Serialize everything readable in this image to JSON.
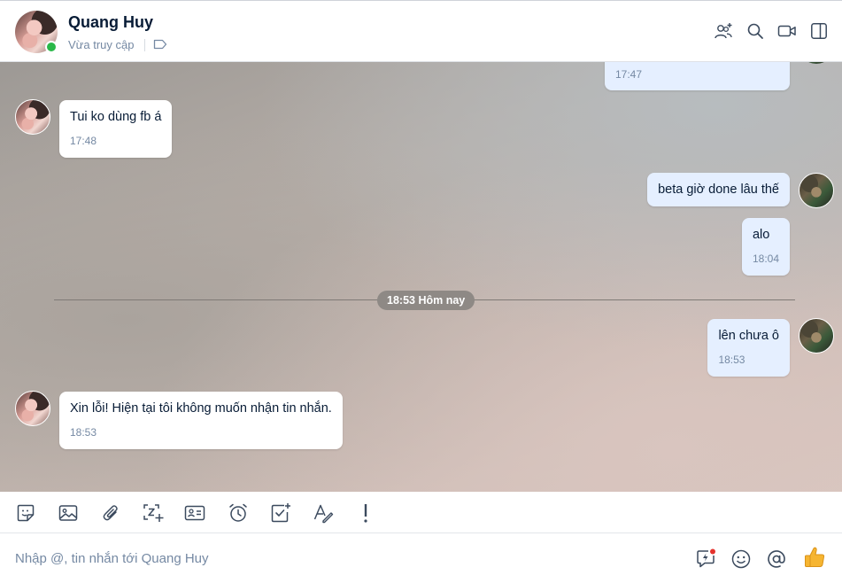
{
  "header": {
    "contact_name": "Quang Huy",
    "status_text": "Vừa truy cập",
    "online": true,
    "actions": [
      "add-member-icon",
      "search-icon",
      "video-call-icon",
      "toggle-panel-icon"
    ]
  },
  "messages": [
    {
      "direction": "out",
      "text": "",
      "time": "17:47"
    },
    {
      "direction": "in",
      "text": "Tui ko dùng fb á",
      "time": "17:48"
    },
    {
      "direction": "out",
      "text": "beta giờ done lâu thế",
      "time": ""
    },
    {
      "direction": "out",
      "text": "alo",
      "time": "18:04"
    },
    {
      "direction": "out",
      "text": "lên chưa ô",
      "time": "18:53"
    },
    {
      "direction": "in",
      "text": "Xin lỗi! Hiện tại tôi không muốn nhận tin nhắn.",
      "time": "18:53"
    }
  ],
  "date_divider": "18:53 Hôm nay",
  "toolbar": {
    "tools": [
      "sticker-icon",
      "image-icon",
      "attachment-icon",
      "screenshot-icon",
      "contact-card-icon",
      "reminder-icon",
      "todo-icon",
      "format-text-icon",
      "urgent-icon"
    ]
  },
  "composer": {
    "placeholder": "Nhập @, tin nhắn tới Quang Huy",
    "value": "",
    "icons": [
      "quick-message-icon",
      "emoji-icon",
      "mention-icon",
      "thumbs-up-icon"
    ]
  },
  "colors": {
    "online": "#2ab849",
    "outgoing_bubble": "#e5efff",
    "incoming_bubble": "#ffffff",
    "icon": "#3b4a5e",
    "notification_dot": "#e5322d"
  }
}
